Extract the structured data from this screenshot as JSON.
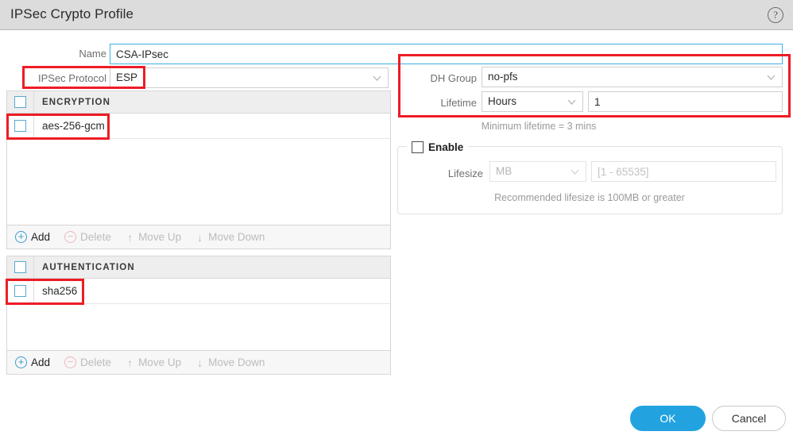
{
  "window": {
    "title": "IPSec Crypto Profile",
    "help_icon": "question-circle-icon"
  },
  "form": {
    "name": {
      "label": "Name",
      "value": "CSA-IPsec"
    },
    "ipsec_protocol": {
      "label": "IPSec Protocol",
      "value": "ESP"
    },
    "dh_group": {
      "label": "DH Group",
      "value": "no-pfs"
    },
    "lifetime": {
      "label": "Lifetime",
      "unit": "Hours",
      "value": "1"
    },
    "lifetime_hint": "Minimum lifetime = 3 mins",
    "enable": {
      "label": "Enable",
      "checked": false
    },
    "lifesize": {
      "label": "Lifesize",
      "unit": "MB",
      "placeholder": "[1 - 65535]",
      "value": ""
    },
    "lifesize_hint": "Recommended lifesize is 100MB or greater"
  },
  "encryption_panel": {
    "header": "ENCRYPTION",
    "rows": [
      {
        "label": "aes-256-gcm",
        "checked": false
      }
    ],
    "toolbar": [
      {
        "label": "Add",
        "icon": "plus-circle-icon",
        "enabled": true
      },
      {
        "label": "Delete",
        "icon": "minus-circle-icon",
        "enabled": false
      },
      {
        "label": "Move Up",
        "icon": "arrow-up-icon",
        "enabled": false
      },
      {
        "label": "Move Down",
        "icon": "arrow-down-icon",
        "enabled": false
      }
    ]
  },
  "authentication_panel": {
    "header": "AUTHENTICATION",
    "rows": [
      {
        "label": "sha256",
        "checked": false
      }
    ],
    "toolbar": [
      {
        "label": "Add",
        "icon": "plus-circle-icon",
        "enabled": true
      },
      {
        "label": "Delete",
        "icon": "minus-circle-icon",
        "enabled": false
      },
      {
        "label": "Move Up",
        "icon": "arrow-up-icon",
        "enabled": false
      },
      {
        "label": "Move Down",
        "icon": "arrow-down-icon",
        "enabled": false
      }
    ]
  },
  "footer": {
    "ok_label": "OK",
    "cancel_label": "Cancel"
  },
  "colors": {
    "accent_blue": "#22a3e0",
    "annotation_red": "#ee1c25",
    "titlebar_grey": "#dcdcdc",
    "checkbox_blue": "#57a9d1"
  }
}
